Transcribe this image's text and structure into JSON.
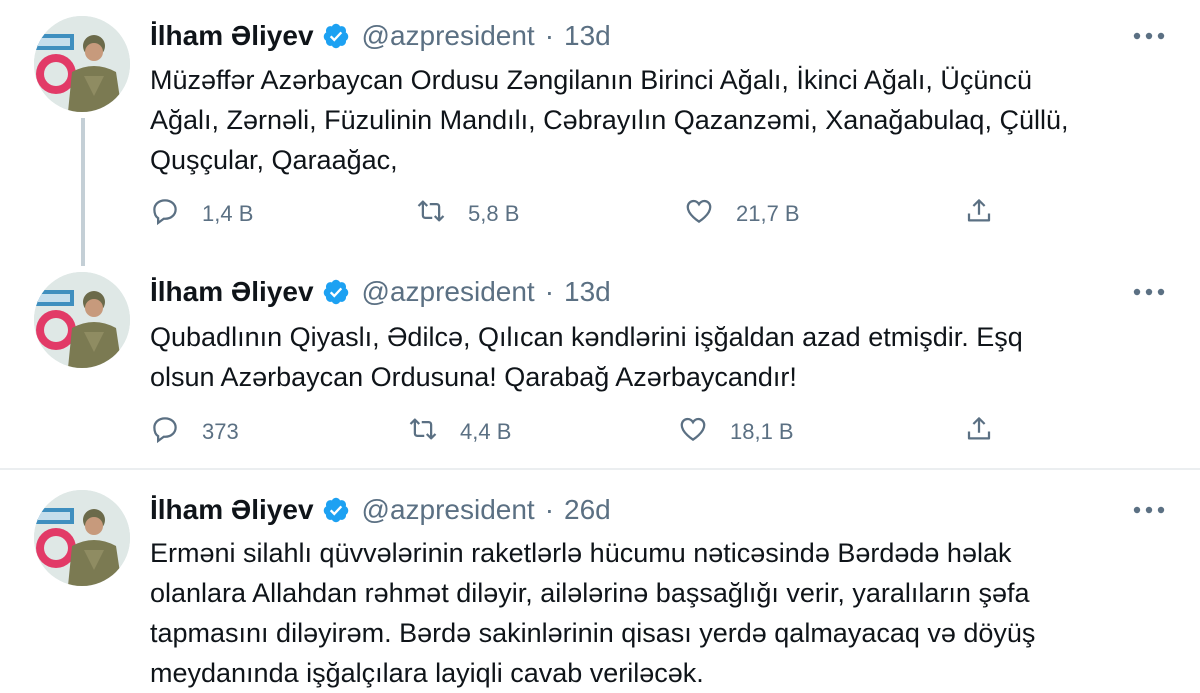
{
  "tweets": [
    {
      "author": "İlham Əliyev",
      "handle": "@azpresident",
      "separator": "·",
      "time": "13d",
      "lines": [
        "Müzəffər Azərbaycan Ordusu Zəngilanın Birinci Ağalı, İkinci Ağalı, Üçüncü",
        "Ağalı, Zərnəli, Füzulinin Mandılı, Cəbrayılın Qazanzəmi, Xanağabulaq, Çüllü,",
        "Quşçular, Qaraağac,"
      ],
      "replies": "1,4 B",
      "retweets": "5,8 B",
      "likes": "21,7 B"
    },
    {
      "author": "İlham Əliyev",
      "handle": "@azpresident",
      "separator": "·",
      "time": "13d",
      "lines": [
        "Qubadlının Qiyaslı, Ədilcə, Qılıcan kəndlərini işğaldan azad etmişdir. Eşq",
        "olsun Azərbaycan Ordusuna! Qarabağ Azərbaycandır!"
      ],
      "replies": "373",
      "retweets": "4,4 B",
      "likes": "18,1 B"
    },
    {
      "author": "İlham Əliyev",
      "handle": "@azpresident",
      "separator": "·",
      "time": "26d",
      "lines": [
        "Erməni silahlı qüvvələrinin raketlərlə hücumu nəticəsində Bərdədə həlak",
        "olanlara Allahdan rəhmət diləyir, ailələrinə başsağlığı verir, yaralıların şəfa",
        "tapmasını diləyirəm. Bərdə sakinlərinin qisası yerdə qalmayacaq və döyüş",
        "meydanında işğalçılara layiqli cavab veriləcək."
      ]
    }
  ],
  "icons": {
    "verified": "verified-badge-icon",
    "more": "more-options-icon",
    "reply": "reply-icon",
    "retweet": "retweet-icon",
    "like": "heart-icon",
    "share": "share-icon"
  },
  "colors": {
    "verified": "#1da1f2",
    "muted": "#5b7083",
    "text": "#0f1419",
    "divider": "#ebeef0",
    "thread_line": "#c4cfd6"
  }
}
